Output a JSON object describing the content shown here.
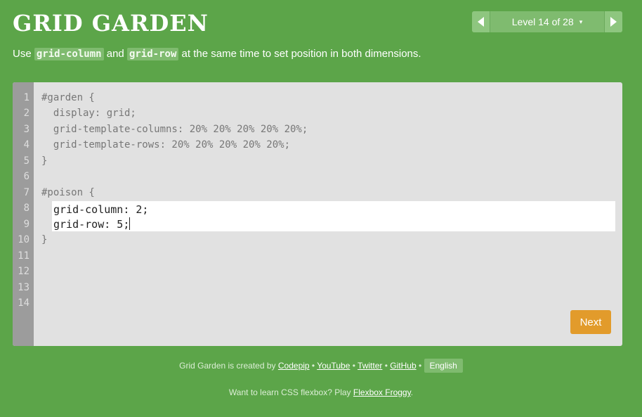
{
  "header": {
    "title": "GRID GARDEN",
    "level_label": "Level 14 of 28",
    "caret": "▾"
  },
  "instructions": {
    "prefix": "Use ",
    "code1": "grid-column",
    "middle": " and ",
    "code2": "grid-row",
    "suffix": " at the same time to set position in both dimensions."
  },
  "editor": {
    "line_numbers": [
      "1",
      "2",
      "3",
      "4",
      "5",
      "6",
      "7",
      "8",
      "9",
      "10",
      "11",
      "12",
      "13",
      "14"
    ],
    "lines": [
      "#garden {",
      "  display: grid;",
      "  grid-template-columns: 20% 20% 20% 20% 20%;",
      "  grid-template-rows: 20% 20% 20% 20% 20%;",
      "}",
      "",
      "#poison {"
    ],
    "input_lines": [
      "grid-column: 2;",
      "grid-row: 5;"
    ],
    "closing_line": "}",
    "next_label": "Next"
  },
  "footer": {
    "created_prefix": "Grid Garden is created by ",
    "codepip": "Codepip",
    "youtube": "YouTube",
    "twitter": "Twitter",
    "github": "GitHub",
    "sep": " • ",
    "language": "English",
    "flexbox_prefix": "Want to learn CSS flexbox? Play ",
    "flexbox_link": "Flexbox Froggy",
    "flexbox_suffix": "."
  },
  "colors": {
    "background": "#5ca549",
    "editor_bg": "#e1e1e1",
    "gutter": "#9c9c9c",
    "next_button": "#e29b2b"
  }
}
